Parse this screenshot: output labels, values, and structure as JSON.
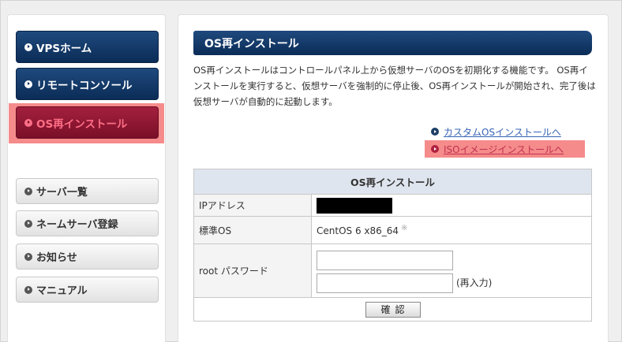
{
  "sidebar": {
    "primary": [
      {
        "label": "VPSホーム",
        "active": false
      },
      {
        "label": "リモートコンソール",
        "active": false
      },
      {
        "label": "OS再インストール",
        "active": true
      }
    ],
    "secondary": [
      {
        "label": "サーバ一覧"
      },
      {
        "label": "ネームサーバ登録"
      },
      {
        "label": "お知らせ"
      },
      {
        "label": "マニュアル"
      }
    ]
  },
  "main": {
    "title": "OS再インストール",
    "description": "OS再インストールはコントロールパネル上から仮想サーバのOSを初期化する機能です。 OS再インストールを実行すると、仮想サーバを強制的に停止後、OS再インストールが開始され、完了後は仮想サーバが自動的に起動します。",
    "links": [
      {
        "label": "カスタムOSインストールへ",
        "highlighted": false
      },
      {
        "label": "ISOイメージインストールへ",
        "highlighted": true
      }
    ],
    "form": {
      "caption": "OS再インストール",
      "ip_label": "IPアドレス",
      "os_label": "標準OS",
      "os_value": "CentOS 6 x86_64",
      "os_note": "※",
      "password_label": "root パスワード",
      "password_value": "",
      "password_confirm_value": "",
      "reenter_label": "(再入力)",
      "confirm_button": "確認"
    }
  },
  "colors": {
    "nav_blue": "#0b2c57",
    "nav_active": "#7a0f28",
    "highlight": "#f58b8b",
    "link": "#3663b5"
  }
}
